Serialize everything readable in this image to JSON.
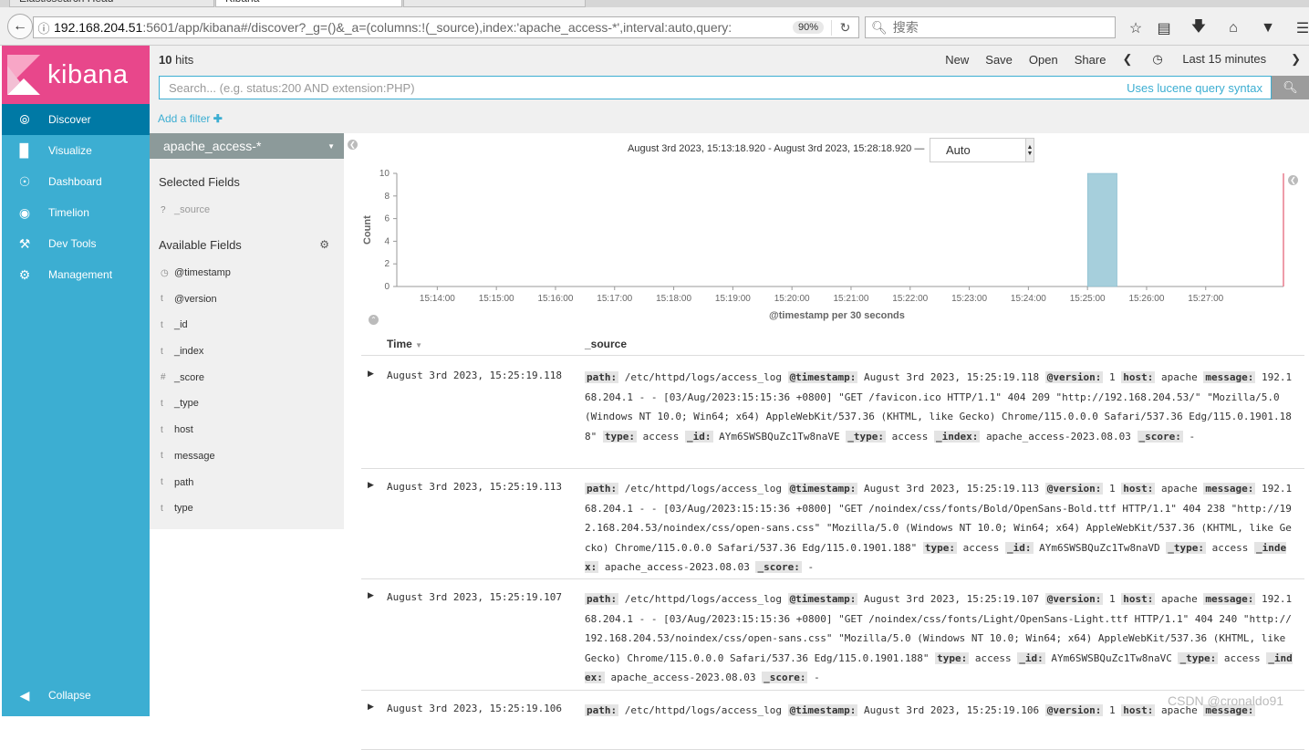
{
  "browser": {
    "tabs": [
      "Elasticsearch Head",
      "Kibana",
      ""
    ],
    "url_host": "192.168.204.51",
    "url_rest": ":5601/app/kibana#/discover?_g=()&_a=(columns:!(_source),index:'apache_access-*',interval:auto,query:",
    "zoom": "90%",
    "search_placeholder": "搜索"
  },
  "sidebar": {
    "brand": "kibana",
    "items": [
      {
        "label": "Discover",
        "icon": "compass-icon"
      },
      {
        "label": "Visualize",
        "icon": "bar-chart-icon"
      },
      {
        "label": "Dashboard",
        "icon": "dashboard-icon"
      },
      {
        "label": "Timelion",
        "icon": "timelion-icon"
      },
      {
        "label": "Dev Tools",
        "icon": "wrench-icon"
      },
      {
        "label": "Management",
        "icon": "gear-icon"
      }
    ],
    "collapse_label": "Collapse"
  },
  "topbar": {
    "hits_count": "10",
    "hits_label": " hits",
    "menu": [
      "New",
      "Save",
      "Open",
      "Share"
    ],
    "time_label": "Last 15 minutes"
  },
  "query": {
    "placeholder": "Search... (e.g. status:200 AND extension:PHP)",
    "help": "Uses lucene query syntax",
    "add_filter": "Add a filter"
  },
  "fields": {
    "index_pattern": "apache_access-*",
    "selected_title": "Selected Fields",
    "selected": [
      {
        "type": "?",
        "name": "_source"
      }
    ],
    "available_title": "Available Fields",
    "available": [
      {
        "type": "◷",
        "name": "@timestamp"
      },
      {
        "type": "t",
        "name": "@version"
      },
      {
        "type": "t",
        "name": "_id"
      },
      {
        "type": "t",
        "name": "_index"
      },
      {
        "type": "#",
        "name": "_score"
      },
      {
        "type": "t",
        "name": "_type"
      },
      {
        "type": "t",
        "name": "host"
      },
      {
        "type": "t",
        "name": "message"
      },
      {
        "type": "t",
        "name": "path"
      },
      {
        "type": "t",
        "name": "type"
      }
    ]
  },
  "histogram": {
    "range_text": "August 3rd 2023, 15:13:18.920 - August 3rd 2023, 15:28:18.920 —",
    "interval": "Auto",
    "ylabel": "Count",
    "xlabel": "@timestamp per 30 seconds"
  },
  "chart_data": {
    "type": "bar",
    "ylabel": "Count",
    "xlabel": "@timestamp per 30 seconds",
    "ylim": [
      0,
      10
    ],
    "yticks": [
      0,
      2,
      4,
      6,
      8,
      10
    ],
    "xticks": [
      "15:14:00",
      "15:15:00",
      "15:16:00",
      "15:17:00",
      "15:18:00",
      "15:19:00",
      "15:20:00",
      "15:21:00",
      "15:22:00",
      "15:23:00",
      "15:24:00",
      "15:25:00",
      "15:26:00",
      "15:27:00"
    ],
    "x_start": "15:13:18.920",
    "x_end": "15:28:18.920",
    "bars": [
      {
        "x": "15:25:00",
        "value": 10
      }
    ],
    "bar_color": "#a6cfdc",
    "end_marker_color": "#e87a8c"
  },
  "table": {
    "col_time": "Time",
    "col_source": "_source",
    "rows": [
      {
        "time": "August 3rd 2023, 15:25:19.118",
        "fields": [
          {
            "k": "path:",
            "v": "/etc/httpd/logs/access_log"
          },
          {
            "k": "@timestamp:",
            "v": "August 3rd 2023, 15:25:19.118"
          },
          {
            "k": "@version:",
            "v": "1"
          },
          {
            "k": "host:",
            "v": "apache"
          },
          {
            "k": "message:",
            "v": "192.168.204.1 - - [03/Aug/2023:15:15:36 +0800] \"GET /favicon.ico HTTP/1.1\" 404 209 \"http://192.168.204.53/\" \"Mozilla/5.0 (Windows NT 10.0; Win64; x64) AppleWebKit/537.36 (KHTML, like Gecko) Chrome/115.0.0.0 Safari/537.36 Edg/115.0.1901.188\""
          },
          {
            "k": "type:",
            "v": "access"
          },
          {
            "k": "_id:",
            "v": "AYm6SWSBQuZc1Tw8naVE"
          },
          {
            "k": "_type:",
            "v": "access"
          },
          {
            "k": "_index:",
            "v": "apache_access-2023.08.03"
          },
          {
            "k": "_score:",
            "v": "-"
          }
        ]
      },
      {
        "time": "August 3rd 2023, 15:25:19.113",
        "fields": [
          {
            "k": "path:",
            "v": "/etc/httpd/logs/access_log"
          },
          {
            "k": "@timestamp:",
            "v": "August 3rd 2023, 15:25:19.113"
          },
          {
            "k": "@version:",
            "v": "1"
          },
          {
            "k": "host:",
            "v": "apache"
          },
          {
            "k": "message:",
            "v": "192.168.204.1 - - [03/Aug/2023:15:15:36 +0800] \"GET /noindex/css/fonts/Bold/OpenSans-Bold.ttf HTTP/1.1\" 404 238 \"http://192.168.204.53/noindex/css/open-sans.css\" \"Mozilla/5.0 (Windows NT 10.0; Win64; x64) AppleWebKit/537.36 (KHTML, like Gecko) Chrome/115.0.0.0 Safari/537.36 Edg/115.0.1901.188\""
          },
          {
            "k": "type:",
            "v": "access"
          },
          {
            "k": "_id:",
            "v": "AYm6SWSBQuZc1Tw8naVD"
          },
          {
            "k": "_type:",
            "v": "access"
          },
          {
            "k": "_index:",
            "v": "apache_access-2023.08.03"
          },
          {
            "k": "_score:",
            "v": "-"
          }
        ]
      },
      {
        "time": "August 3rd 2023, 15:25:19.107",
        "fields": [
          {
            "k": "path:",
            "v": "/etc/httpd/logs/access_log"
          },
          {
            "k": "@timestamp:",
            "v": "August 3rd 2023, 15:25:19.107"
          },
          {
            "k": "@version:",
            "v": "1"
          },
          {
            "k": "host:",
            "v": "apache"
          },
          {
            "k": "message:",
            "v": "192.168.204.1 - - [03/Aug/2023:15:15:36 +0800] \"GET /noindex/css/fonts/Light/OpenSans-Light.ttf HTTP/1.1\" 404 240 \"http://192.168.204.53/noindex/css/open-sans.css\" \"Mozilla/5.0 (Windows NT 10.0; Win64; x64) AppleWebKit/537.36 (KHTML, like Gecko) Chrome/115.0.0.0 Safari/537.36 Edg/115.0.1901.188\""
          },
          {
            "k": "type:",
            "v": "access"
          },
          {
            "k": "_id:",
            "v": "AYm6SWSBQuZc1Tw8naVC"
          },
          {
            "k": "_type:",
            "v": "access"
          },
          {
            "k": "_index:",
            "v": "apache_access-2023.08.03"
          },
          {
            "k": "_score:",
            "v": "-"
          }
        ]
      },
      {
        "time": "August 3rd 2023, 15:25:19.106",
        "fields": [
          {
            "k": "path:",
            "v": "/etc/httpd/logs/access_log"
          },
          {
            "k": "@timestamp:",
            "v": "August 3rd 2023, 15:25:19.106"
          },
          {
            "k": "@version:",
            "v": "1"
          },
          {
            "k": "host:",
            "v": "apache"
          },
          {
            "k": "message:",
            "v": ""
          }
        ]
      }
    ]
  },
  "watermark": "CSDN @cronaldo91"
}
